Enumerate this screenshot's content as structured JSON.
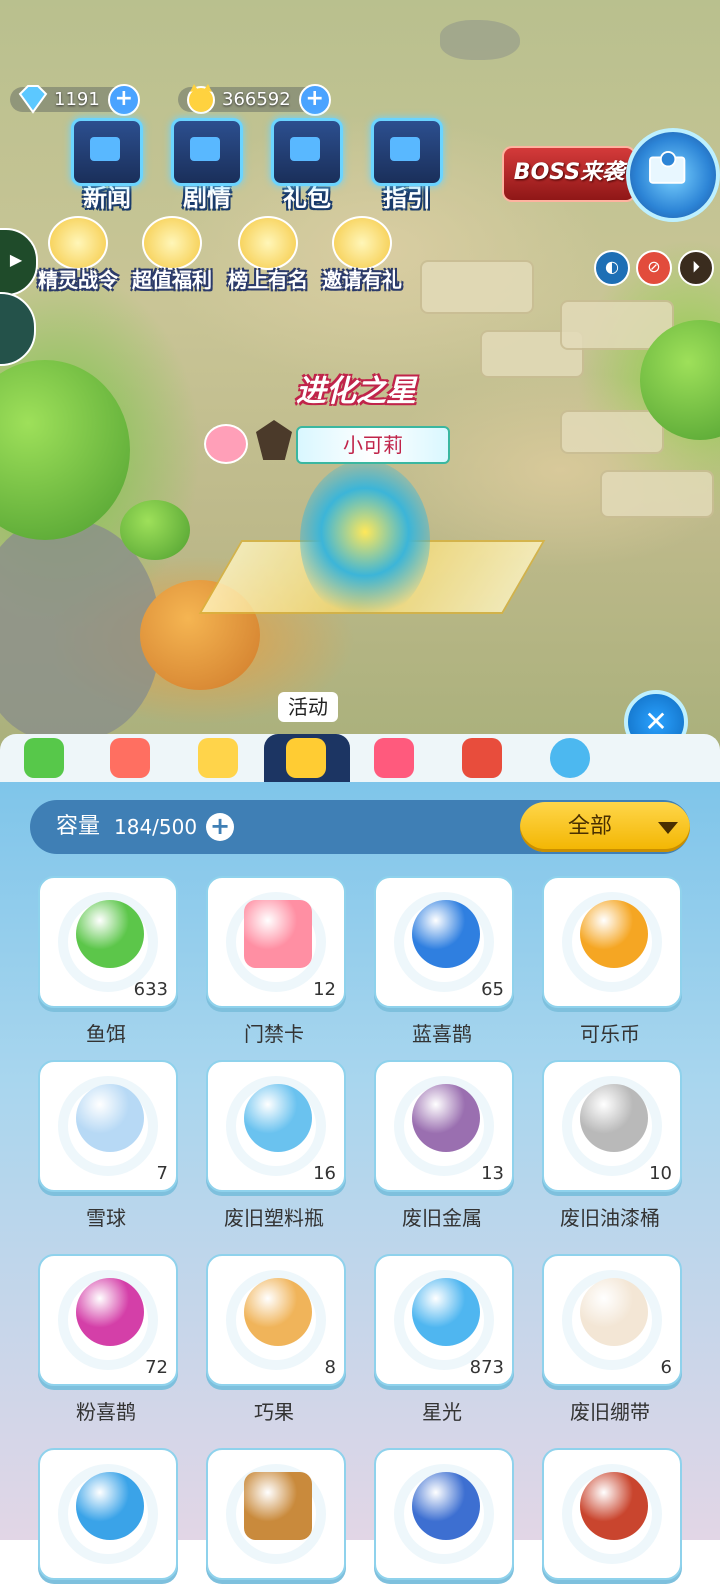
{
  "hud": {
    "gems": "1191",
    "coins": "366592",
    "buttons": [
      "新闻",
      "剧情",
      "礼包",
      "指引"
    ],
    "events": [
      "精灵战令",
      "超值福利",
      "榜上有名",
      "邀请有礼"
    ],
    "boss_banner": "BOSS来袭"
  },
  "scene": {
    "player_title": "进化之星",
    "player_name": "小可莉",
    "activity_tooltip": "活动"
  },
  "bag": {
    "tabs": [
      {
        "icon": "battery-icon",
        "color": "#57c84a"
      },
      {
        "icon": "blocks-icon",
        "color": "#ff6f61"
      },
      {
        "icon": "star-wand-icon",
        "color": "#ffd44a"
      },
      {
        "icon": "activity-star-icon",
        "color": "#ffcc33",
        "active": true
      },
      {
        "icon": "dress-icon",
        "color": "#ff5a7d"
      },
      {
        "icon": "rocking-horse-icon",
        "color": "#e84d3c"
      },
      {
        "icon": "egg-icon",
        "color": "#4cb8f0"
      }
    ],
    "capacity_label": "容量",
    "capacity_value": "184/500",
    "filter_label": "全部",
    "items": [
      {
        "name": "鱼饵",
        "count": "633",
        "icon": "worm-icon",
        "color": "#5cc64a"
      },
      {
        "name": "门禁卡",
        "count": "12",
        "icon": "access-card-icon",
        "color": "#ff8fa3"
      },
      {
        "name": "蓝喜鹊",
        "count": "65",
        "icon": "blue-bird-icon",
        "color": "#2f7fe0"
      },
      {
        "name": "可乐币",
        "count": "",
        "icon": "cola-coin-icon",
        "color": "#f5a623"
      },
      {
        "name": "雪球",
        "count": "7",
        "icon": "snowball-icon",
        "color": "#b7d9f5"
      },
      {
        "name": "废旧塑料瓶",
        "count": "16",
        "icon": "water-bottle-icon",
        "color": "#6ac2ef"
      },
      {
        "name": "废旧金属",
        "count": "13",
        "icon": "magnet-icon",
        "color": "#9a6fb0"
      },
      {
        "name": "废旧油漆桶",
        "count": "10",
        "icon": "paint-bucket-icon",
        "color": "#b9b9b9"
      },
      {
        "name": "粉喜鹊",
        "count": "72",
        "icon": "pink-bird-icon",
        "color": "#d43fa8"
      },
      {
        "name": "巧果",
        "count": "8",
        "icon": "fish-cookie-icon",
        "color": "#f0b45a"
      },
      {
        "name": "星光",
        "count": "873",
        "icon": "star-crystal-icon",
        "color": "#4fb6f0"
      },
      {
        "name": "废旧绷带",
        "count": "6",
        "icon": "bandage-icon",
        "color": "#f3e6d5"
      },
      {
        "name": "",
        "count": "",
        "icon": "blue-crystal-icon",
        "color": "#3aa3e8"
      },
      {
        "name": "",
        "count": "",
        "icon": "wood-planks-icon",
        "color": "#c98a3c"
      },
      {
        "name": "",
        "count": "",
        "icon": "hammer-icon",
        "color": "#3d6fd1"
      },
      {
        "name": "",
        "count": "",
        "icon": "arrow-icon",
        "color": "#c9452e"
      }
    ]
  }
}
